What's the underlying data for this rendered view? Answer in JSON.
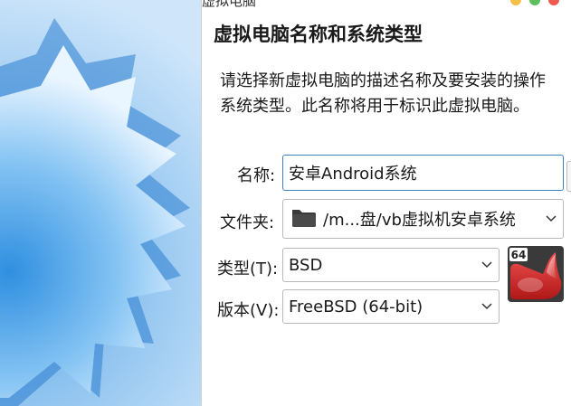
{
  "window": {
    "title": "新建虚拟电脑"
  },
  "page": {
    "heading": "虚拟电脑名称和系统类型",
    "description": "请选择新虚拟电脑的描述名称及要安装的操作系统类型。此名称将用于标识此虚拟电脑。"
  },
  "form": {
    "name_label": "名称:",
    "name_value": "安卓Android系统",
    "folder_label": "文件夹:",
    "folder_value": "/m...盘/vb虚拟机安卓系统",
    "type_label": "类型(T):",
    "type_value": "BSD",
    "version_label": "版本(V):",
    "version_value": "FreeBSD (64-bit)"
  },
  "os_badge": {
    "bits": "64",
    "icon": "freebsd-icon"
  },
  "colors": {
    "accent_border": "#3b82c4",
    "art_blue": "#9bc7ee",
    "os_red": "#d62424"
  }
}
